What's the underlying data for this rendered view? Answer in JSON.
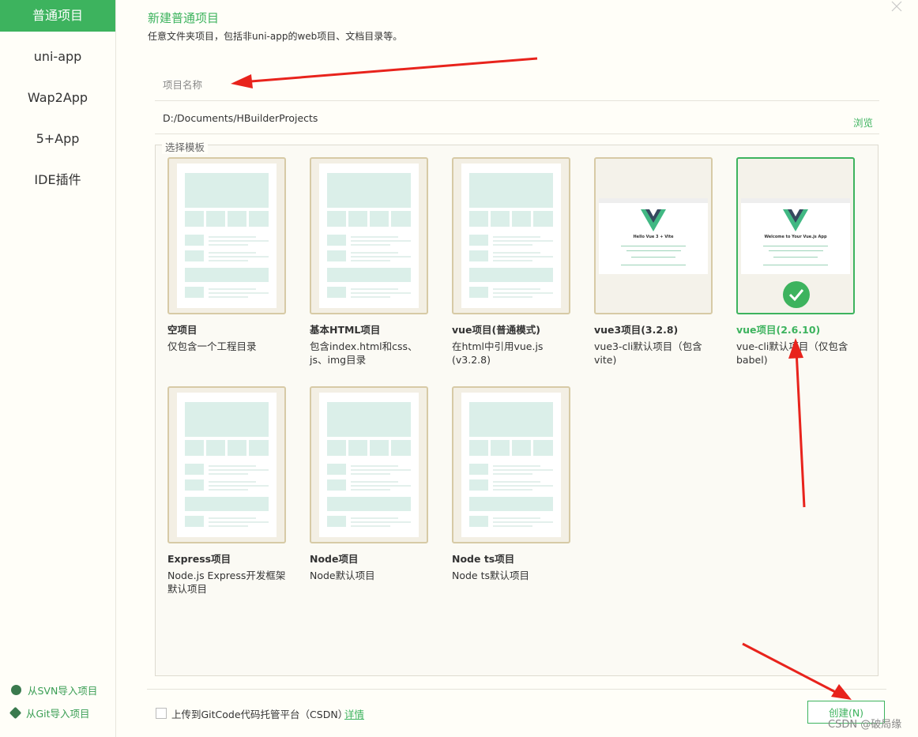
{
  "sidebar": {
    "items": [
      {
        "label": "普通项目",
        "active": true
      },
      {
        "label": "uni-app"
      },
      {
        "label": "Wap2App"
      },
      {
        "label": "5+App"
      },
      {
        "label": "IDE插件"
      }
    ],
    "import_svn": "从SVN导入项目",
    "import_git": "从Git导入项目"
  },
  "header": {
    "title": "新建普通项目",
    "subtitle": "任意文件夹项目，包括非uni-app的web项目、文档目录等。"
  },
  "form": {
    "name_placeholder": "项目名称",
    "path_value": "D:/Documents/HBuilderProjects",
    "browse_label": "浏览",
    "template_legend": "选择模板"
  },
  "templates": [
    {
      "name": "空项目",
      "desc": "仅包含一个工程目录"
    },
    {
      "name": "基本HTML项目",
      "desc": "包含index.html和css、js、img目录"
    },
    {
      "name": "vue项目(普通模式)",
      "desc": "在html中引用vue.js (v3.2.8)"
    },
    {
      "name": "vue3项目(3.2.8)",
      "desc": "vue3-cli默认项目（包含vite)",
      "preview": "Hello Vue 3 + Vite"
    },
    {
      "name": "vue项目(2.6.10)",
      "desc": "vue-cli默认项目（仅包含babel)",
      "preview": "Welcome to Your Vue.js App",
      "selected": true
    },
    {
      "name": "Express项目",
      "desc": "Node.js Express开发框架默认项目"
    },
    {
      "name": "Node项目",
      "desc": "Node默认项目"
    },
    {
      "name": "Node ts项目",
      "desc": "Node ts默认项目"
    }
  ],
  "footer": {
    "upload_label": "上传到GitCode代码托管平台（CSDN）",
    "detail_link": "详情",
    "create_button": "创建(N)",
    "watermark": "CSDN @破局缘"
  },
  "colors": {
    "accent": "#3db35e",
    "annotation_arrow": "#e8231c"
  }
}
